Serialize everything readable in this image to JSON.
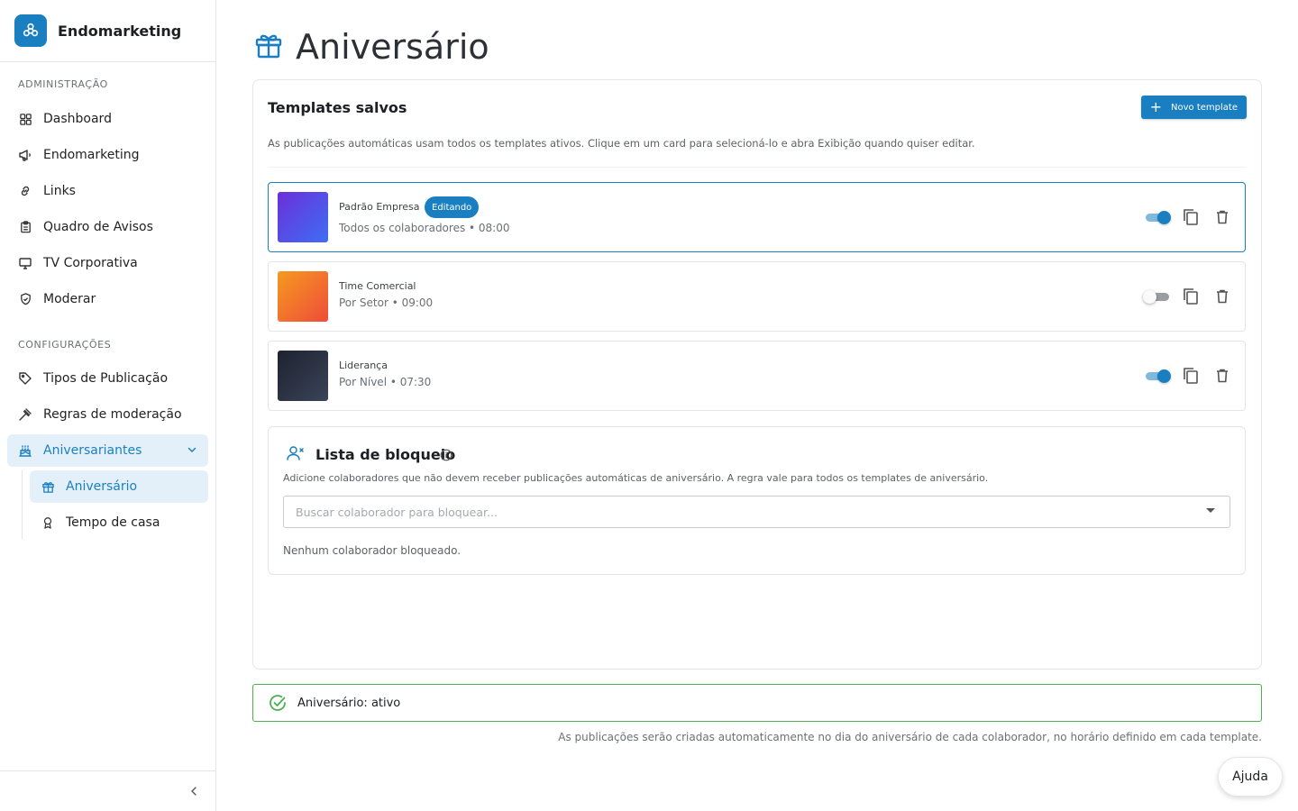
{
  "brand": {
    "name": "Endomarketing",
    "color": "#1a7fc1"
  },
  "sidebar": {
    "sections": [
      {
        "title": "ADMINISTRAÇÃO"
      },
      {
        "title": "CONFIGURAÇÕES"
      }
    ],
    "items": [
      {
        "label": "Dashboard",
        "icon": "dashboard-icon"
      },
      {
        "label": "Endomarketing",
        "icon": "megaphone-icon"
      },
      {
        "label": "Links",
        "icon": "link-icon"
      },
      {
        "label": "Quadro de Avisos",
        "icon": "clipboard-icon"
      },
      {
        "label": "TV Corporativa",
        "icon": "monitor-icon"
      },
      {
        "label": "Moderar",
        "icon": "shield-icon"
      },
      {
        "label": "Tipos de Publicação",
        "icon": "tag-icon"
      },
      {
        "label": "Regras de moderação",
        "icon": "gavel-icon"
      },
      {
        "label": "Aniversariantes",
        "icon": "cake-icon",
        "expanded": true
      },
      {
        "label": "Aniversário",
        "icon": "gift-icon",
        "active": true
      },
      {
        "label": "Tempo de casa",
        "icon": "award-icon"
      }
    ]
  },
  "page": {
    "title": "Aniversário",
    "icon": "gift-icon"
  },
  "templates": {
    "title": "Templates salvos",
    "new_button": "Novo template",
    "description": "As publicações automáticas usam todos os templates ativos. Clique em um card para selecioná-lo e abra Exibição quando quiser editar.",
    "items": [
      {
        "name": "Padrão Empresa",
        "meta": "Todos os colaboradores • 08:00",
        "badge": "Editando",
        "active": true,
        "selected": true,
        "gradient": [
          "#6a2fd9",
          "#3f6ef5"
        ]
      },
      {
        "name": "Time Comercial",
        "meta": "Por Setor • 09:00",
        "badge": "",
        "active": false,
        "selected": false,
        "gradient": [
          "#f59a1f",
          "#ef4c3a"
        ]
      },
      {
        "name": "Liderança",
        "meta": "Por Nível • 07:30",
        "badge": "",
        "active": true,
        "selected": false,
        "gradient": [
          "#1e2230",
          "#3a4458"
        ]
      }
    ]
  },
  "blocklist": {
    "title": "Lista de bloqueio",
    "description": "Adicione colaboradores que não devem receber publicações automáticas de aniversário. A regra vale para todos os templates de aniversário.",
    "placeholder": "Buscar colaborador para bloquear...",
    "empty": "Nenhum colaborador bloqueado."
  },
  "status": {
    "text": "Aniversário: ativo",
    "note": "As publicações serão criadas automaticamente no dia do aniversário de cada colaborador, no horário definido em cada template.",
    "color": "#4caf50"
  },
  "help": {
    "label": "Ajuda"
  }
}
